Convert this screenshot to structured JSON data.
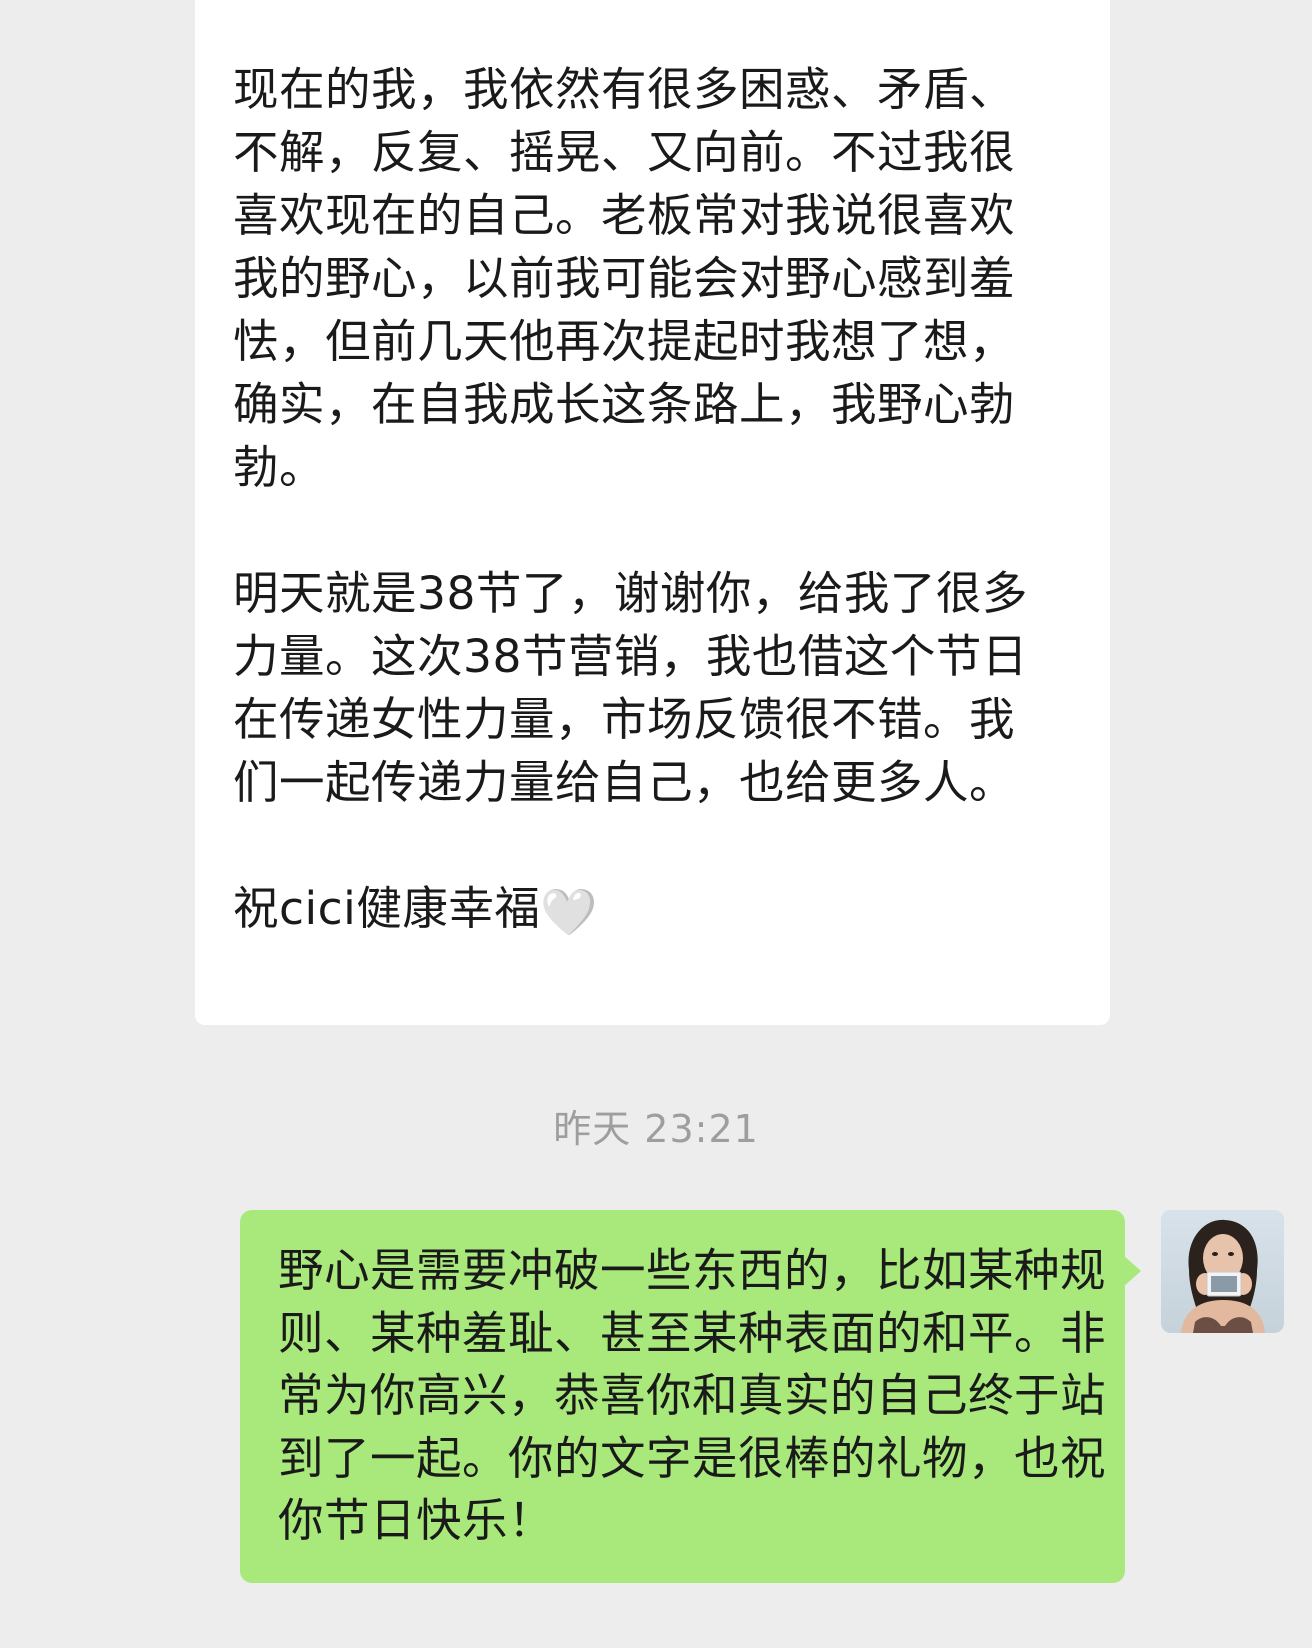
{
  "messages": {
    "incoming": {
      "paragraph1": "现在的我，我依然有很多困惑、矛盾、不解，反复、摇晃、又向前。不过我很喜欢现在的自己。老板常对我说很喜欢我的野心，以前我可能会对野心感到羞怯，但前几天他再次提起时我想了想，确实，在自我成长这条路上，我野心勃勃。",
      "paragraph2": "明天就是38节了，谢谢你，给我了很多力量。这次38节营销，我也借这个节日在传递女性力量，市场反馈很不错。我们一起传递力量给自己，也给更多人。",
      "paragraph3": "祝cici健康幸福",
      "emoji": "🤍",
      "emoji_icon": "white-heart-icon"
    },
    "timestamp": "昨天 23:21",
    "outgoing": {
      "text": "野心是需要冲破一些东西的，比如某种规则、某种羞耻、甚至某种表面的和平。非常为你高兴，恭喜你和真实的自己终于站到了一起。你的文字是很棒的礼物，也祝你节日快乐！"
    }
  },
  "colors": {
    "background": "#ededed",
    "incoming_bubble": "#ffffff",
    "outgoing_bubble": "#a9e97c",
    "timestamp": "#9e9e9e"
  }
}
